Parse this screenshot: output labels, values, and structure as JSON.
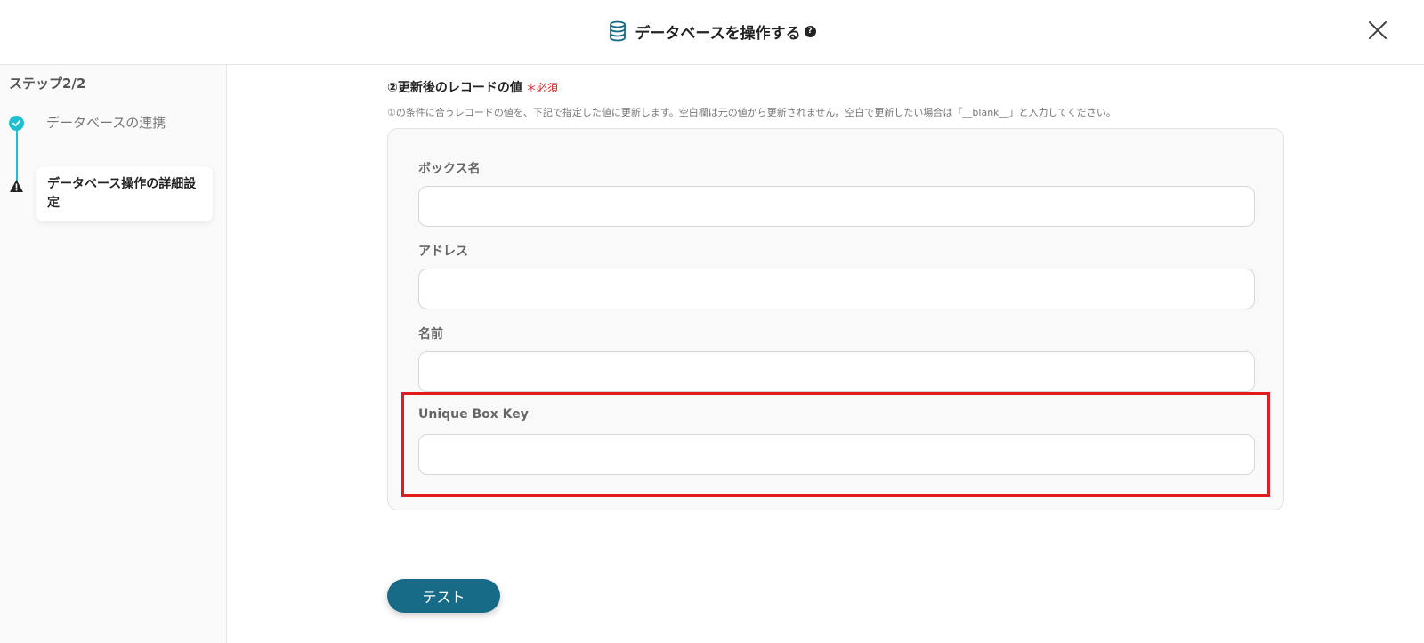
{
  "header": {
    "title": "データベースを操作する",
    "help_glyph": "?"
  },
  "sidebar": {
    "step_count": "ステップ2/2",
    "steps": [
      {
        "label": "データベースの連携",
        "status": "complete"
      },
      {
        "label": "データベース操作の詳細設定",
        "status": "warning"
      }
    ]
  },
  "main": {
    "section_title": "②更新後のレコードの値",
    "required_label": "＊必須",
    "section_description": "①の条件に合うレコードの値を、下記で指定した値に更新します。空白欄は元の値から更新されません。空白で更新したい場合は「__blank__」と入力してください。",
    "fields": [
      {
        "label": "ボックス名",
        "value": ""
      },
      {
        "label": "アドレス",
        "value": ""
      },
      {
        "label": "名前",
        "value": ""
      },
      {
        "label": "Unique Box Key",
        "value": ""
      }
    ],
    "test_button": "テスト"
  },
  "colors": {
    "accent": "#1ec0cf",
    "button": "#176b87",
    "highlight": "#e01d1d",
    "required": "#e02020"
  }
}
